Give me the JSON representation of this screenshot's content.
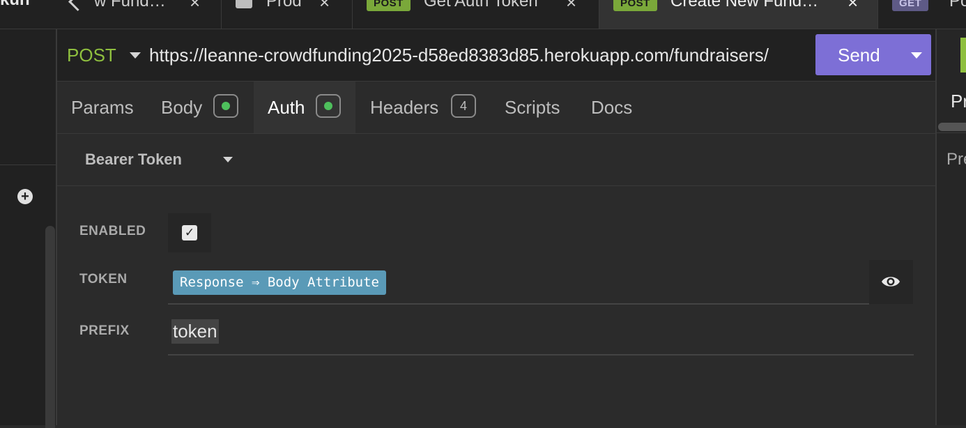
{
  "tabbar": {
    "left_fragment": "kun",
    "tabs": [
      {
        "label": "w Fund…",
        "close": "×"
      },
      {
        "label": "Prod",
        "close": "×"
      },
      {
        "badge": "POST",
        "label": "Get Auth Token",
        "close": "×"
      },
      {
        "badge": "POST",
        "label": "Create New Fund…",
        "close": "×"
      },
      {
        "badge": "GET",
        "label": "Po"
      }
    ]
  },
  "request": {
    "method": "POST",
    "url": "https://leanne-crowdfunding2025-d58ed8383d85.herokuapp.com/fundraisers/",
    "send_label": "Send"
  },
  "request_tabs": [
    {
      "label": "Params"
    },
    {
      "label": "Body"
    },
    {
      "label": "Auth"
    },
    {
      "label": "Headers",
      "count": "4"
    },
    {
      "label": "Scripts"
    },
    {
      "label": "Docs"
    }
  ],
  "auth": {
    "type": "Bearer Token",
    "enabled_label": "ENABLED",
    "enabled_check": "✓",
    "token_label": "TOKEN",
    "token_chip": "Response ⇒ Body Attribute",
    "prefix_label": "PREFIX",
    "prefix_value": "token"
  },
  "right_pane": {
    "tab": "Pr",
    "label": "Pre"
  },
  "colors": {
    "accent_send": "#7d6fd6",
    "method_post": "#8fbf3f",
    "token_chip": "#5a9ab7",
    "status_dot": "#4ebf5c"
  }
}
